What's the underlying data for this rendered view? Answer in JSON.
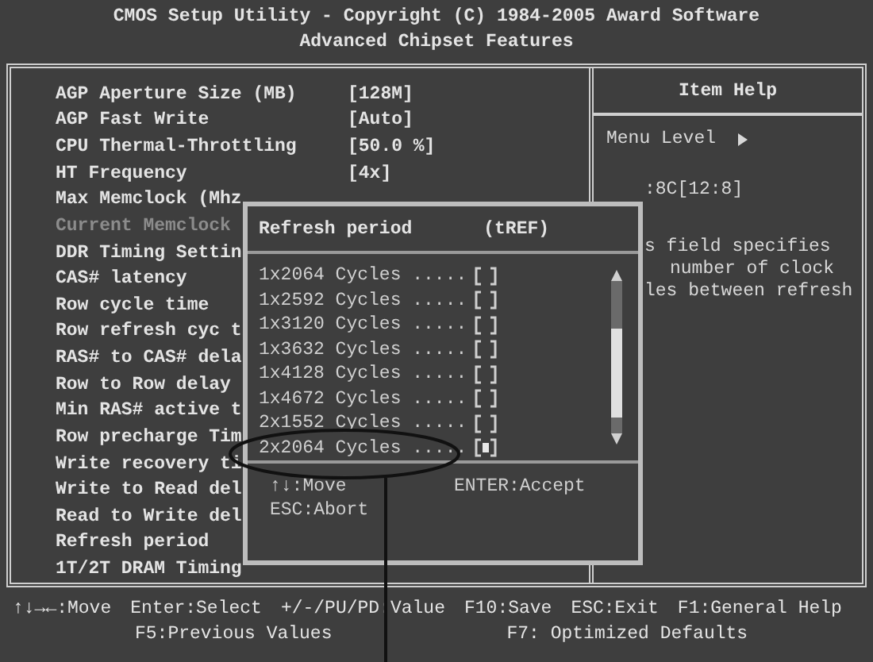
{
  "header": {
    "title": "CMOS Setup Utility - Copyright (C) 1984-2005 Award Software",
    "subtitle": "Advanced Chipset Features"
  },
  "settings": [
    {
      "name": "AGP Aperture Size (MB)",
      "value": "[128M]",
      "disabled": false
    },
    {
      "name": "AGP Fast Write",
      "value": "[Auto]",
      "disabled": false
    },
    {
      "name": "CPU Thermal-Throttling",
      "value": "[50.0 %]",
      "disabled": false
    },
    {
      "name": "HT Frequency",
      "value": "[4x]",
      "disabled": false
    },
    {
      "name": "Max Memclock (Mhz",
      "disabled": false
    },
    {
      "name": "Current Memclock",
      "disabled": true
    },
    {
      "name": "DDR Timing Settin",
      "disabled": false
    },
    {
      "name": "CAS# latency",
      "disabled": false
    },
    {
      "name": "Row cycle time",
      "disabled": false
    },
    {
      "name": "Row refresh cyc t",
      "disabled": false
    },
    {
      "name": "RAS# to CAS# dela",
      "disabled": false
    },
    {
      "name": "Row to Row delay",
      "disabled": false
    },
    {
      "name": "Min RAS# active t",
      "disabled": false
    },
    {
      "name": "Row precharge Tim",
      "disabled": false
    },
    {
      "name": "Write recovery ti",
      "disabled": false
    },
    {
      "name": "Write to Read del",
      "disabled": false
    },
    {
      "name": "Read to Write del",
      "disabled": false
    },
    {
      "name": "Refresh period",
      "disabled": false
    },
    {
      "name": "1T/2T DRAM Timing",
      "disabled": false
    }
  ],
  "help": {
    "title": "Item Help",
    "menu_level": "Menu Level",
    "lines": [
      ":8C[12:8]",
      "s field specifies",
      "number of clock",
      "les between refresh"
    ]
  },
  "popup": {
    "title": "Refresh period",
    "code": "(tREF)",
    "options": [
      {
        "label": "1x2064 Cycles .....",
        "selected": false
      },
      {
        "label": "1x2592 Cycles .....",
        "selected": false
      },
      {
        "label": "1x3120 Cycles .....",
        "selected": false
      },
      {
        "label": "1x3632 Cycles .....",
        "selected": false
      },
      {
        "label": "1x4128 Cycles .....",
        "selected": false
      },
      {
        "label": "1x4672 Cycles .....",
        "selected": false
      },
      {
        "label": "2x1552 Cycles .....",
        "selected": false
      },
      {
        "label": "2x2064 Cycles .....",
        "selected": true
      }
    ],
    "keys": [
      "↑↓:Move",
      "ENTER:Accept",
      "ESC:Abort"
    ]
  },
  "keybar": {
    "row_1": [
      "↑↓→←:Move",
      "Enter:Select",
      "+/-/PU/PD:Value",
      "F10:Save",
      "ESC:Exit",
      "F1:General Help"
    ],
    "row_2": [
      "F5:Previous Values",
      "F7: Optimized Defaults"
    ]
  }
}
